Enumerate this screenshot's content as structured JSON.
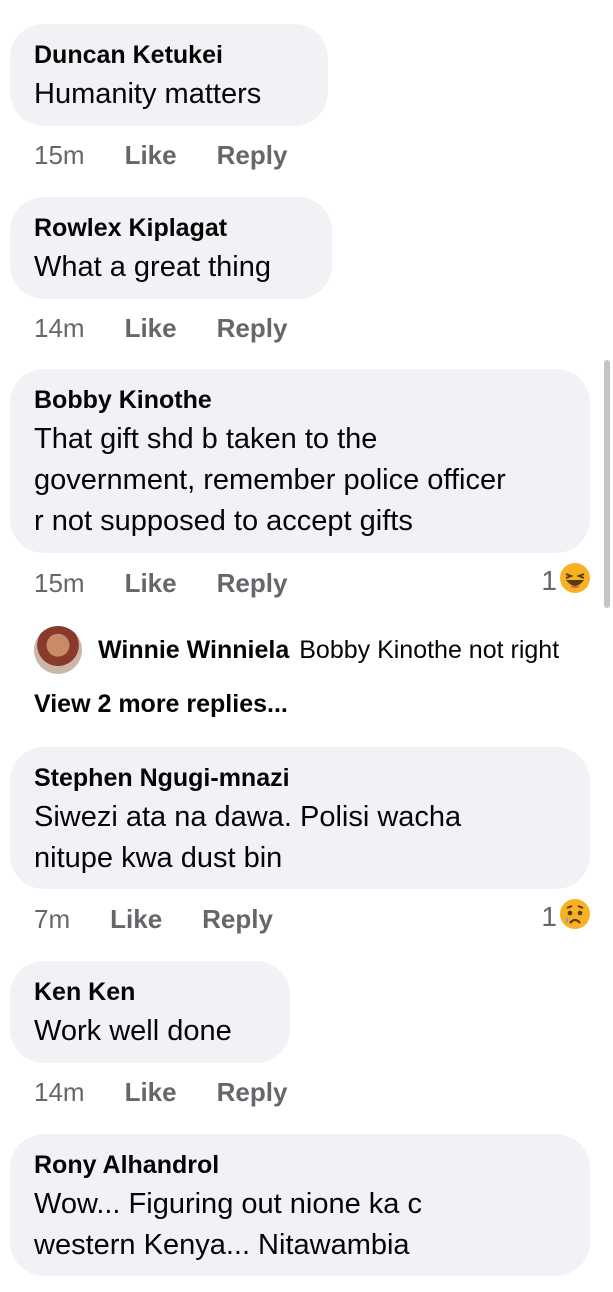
{
  "comments": [
    {
      "author": "Duncan Ketukei",
      "text": "Humanity matters",
      "time": "15m",
      "like": "Like",
      "reply": "Reply"
    },
    {
      "author": "Rowlex Kiplagat",
      "text": "What a great thing",
      "time": "14m",
      "like": "Like",
      "reply": "Reply"
    },
    {
      "author": "Bobby Kinothe",
      "text": "That gift shd b taken to the\ngovernment, remember police officer\nr not supposed to accept gifts",
      "time": "15m",
      "like": "Like",
      "reply": "Reply",
      "reaction_count": "1",
      "reaction_icon": "haha-emoji-icon"
    },
    {
      "author": "Stephen Ngugi-mnazi",
      "text": "Siwezi ata na dawa. Polisi wacha\nnitupe kwa dust bin",
      "time": "7m",
      "like": "Like",
      "reply": "Reply",
      "reaction_count": "1",
      "reaction_icon": "sad-emoji-icon"
    },
    {
      "author": "Ken Ken",
      "text": "Work well done",
      "time": "14m",
      "like": "Like",
      "reply": "Reply"
    },
    {
      "author": "Rony Alhandrol",
      "text": "Wow... Figuring out nione ka c\nwestern Kenya... Nitawambia"
    }
  ],
  "reply_preview": {
    "author": "Winnie Winniela",
    "text": "Bobby Kinothe not right"
  },
  "view_more": "View 2 more replies...",
  "colors": {
    "bubble": "#f0f2f5",
    "meta": "#65676b",
    "text": "#050505"
  }
}
